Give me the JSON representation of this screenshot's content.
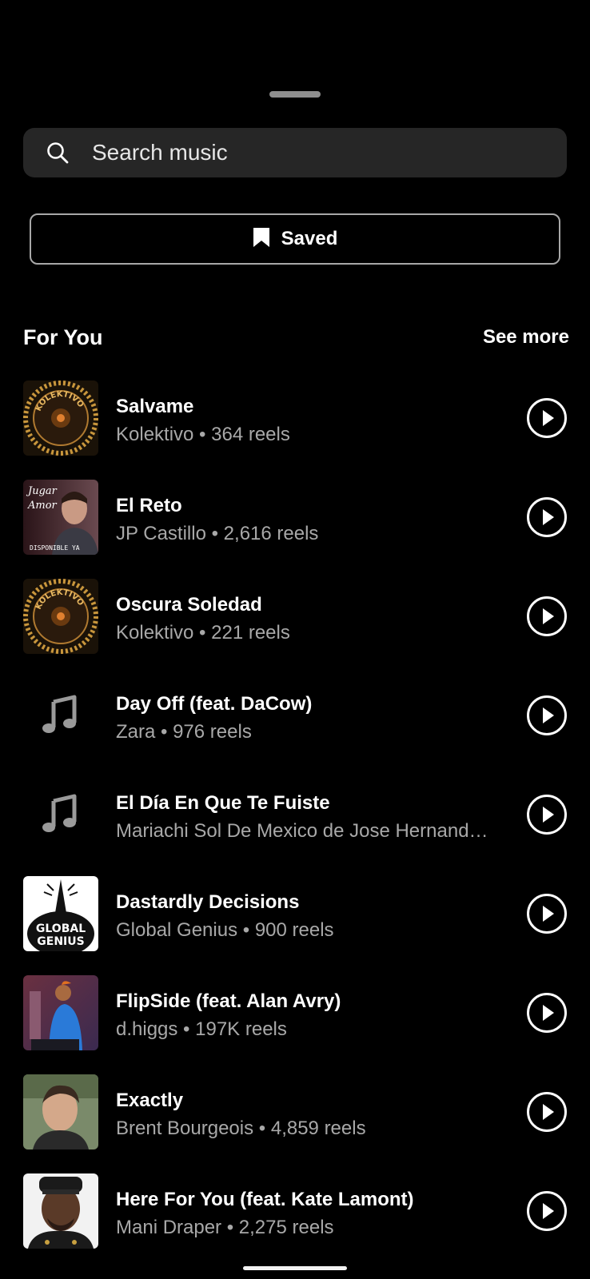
{
  "search": {
    "placeholder": "Search music",
    "icon": "search-icon"
  },
  "saved_button": {
    "label": "Saved",
    "icon": "bookmark-icon"
  },
  "section": {
    "title": "For You",
    "see_more": "See more"
  },
  "tracks": [
    {
      "title": "Salvame",
      "subtitle": "Kolektivo • 364 reels",
      "art": "kolektivo-artwork"
    },
    {
      "title": "El Reto",
      "subtitle": "JP Castillo • 2,616 reels",
      "art": "jp-castillo-artwork"
    },
    {
      "title": "Oscura Soledad",
      "subtitle": "Kolektivo • 221 reels",
      "art": "kolektivo-artwork"
    },
    {
      "title": "Day Off (feat. DaCow)",
      "subtitle": "Zara • 976 reels",
      "art": "music-note-icon"
    },
    {
      "title": "El Día En Que Te Fuiste",
      "subtitle": "Mariachi Sol De Mexico de Jose Hernand…",
      "art": "music-note-icon"
    },
    {
      "title": "Dastardly Decisions",
      "subtitle": "Global Genius • 900 reels",
      "art": "global-genius-artwork"
    },
    {
      "title": "FlipSide (feat. Alan Avry)",
      "subtitle": "d.higgs • 197K reels",
      "art": "d-higgs-artwork"
    },
    {
      "title": "Exactly",
      "subtitle": "Brent Bourgeois • 4,859 reels",
      "art": "brent-bourgeois-artwork"
    },
    {
      "title": "Here For You (feat. Kate Lamont)",
      "subtitle": "Mani Draper • 2,275 reels",
      "art": "mani-draper-artwork"
    }
  ],
  "artwork_text": {
    "kolektivo": "KOLEKTIVO MUSIC",
    "jp_castillo_1": "Jugar",
    "jp_castillo_2": "Amor",
    "jp_castillo_3": "DISPONIBLE YA",
    "global_genius_1": "GLOBAL",
    "global_genius_2": "GENIUS"
  },
  "colors": {
    "background": "#000000",
    "search_bg": "#262626",
    "secondary_text": "#a8a8a8",
    "primary_text": "#ffffff"
  }
}
